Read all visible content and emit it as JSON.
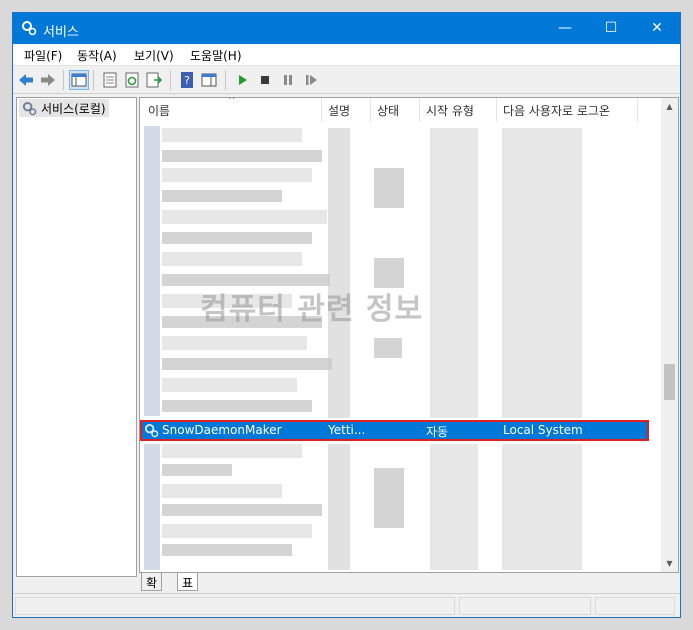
{
  "window": {
    "title": "서비스",
    "minimize": "—",
    "maximize": "☐",
    "close": "✕"
  },
  "menu": {
    "items": [
      "파일(F)",
      "동작(A)",
      "보기(V)",
      "도움말(H)"
    ]
  },
  "tree": {
    "root_label": "서비스(로컬)"
  },
  "columns": {
    "headers": [
      "이름",
      "설명",
      "상태",
      "시작 유형",
      "다음 사용자로 로그온"
    ],
    "sort_arrow": "^"
  },
  "watermark": "컴퓨터 관련 정보",
  "selected_row": {
    "name": "SnowDaemonMaker",
    "description": "Yetti...",
    "status": "",
    "startup_type": "자동",
    "logon_as": "Local System"
  },
  "tabs": [
    "확장",
    "표준"
  ],
  "colors": {
    "titlebar": "#0078d7",
    "selection": "#0078d7",
    "highlight_border": "#e02020"
  }
}
